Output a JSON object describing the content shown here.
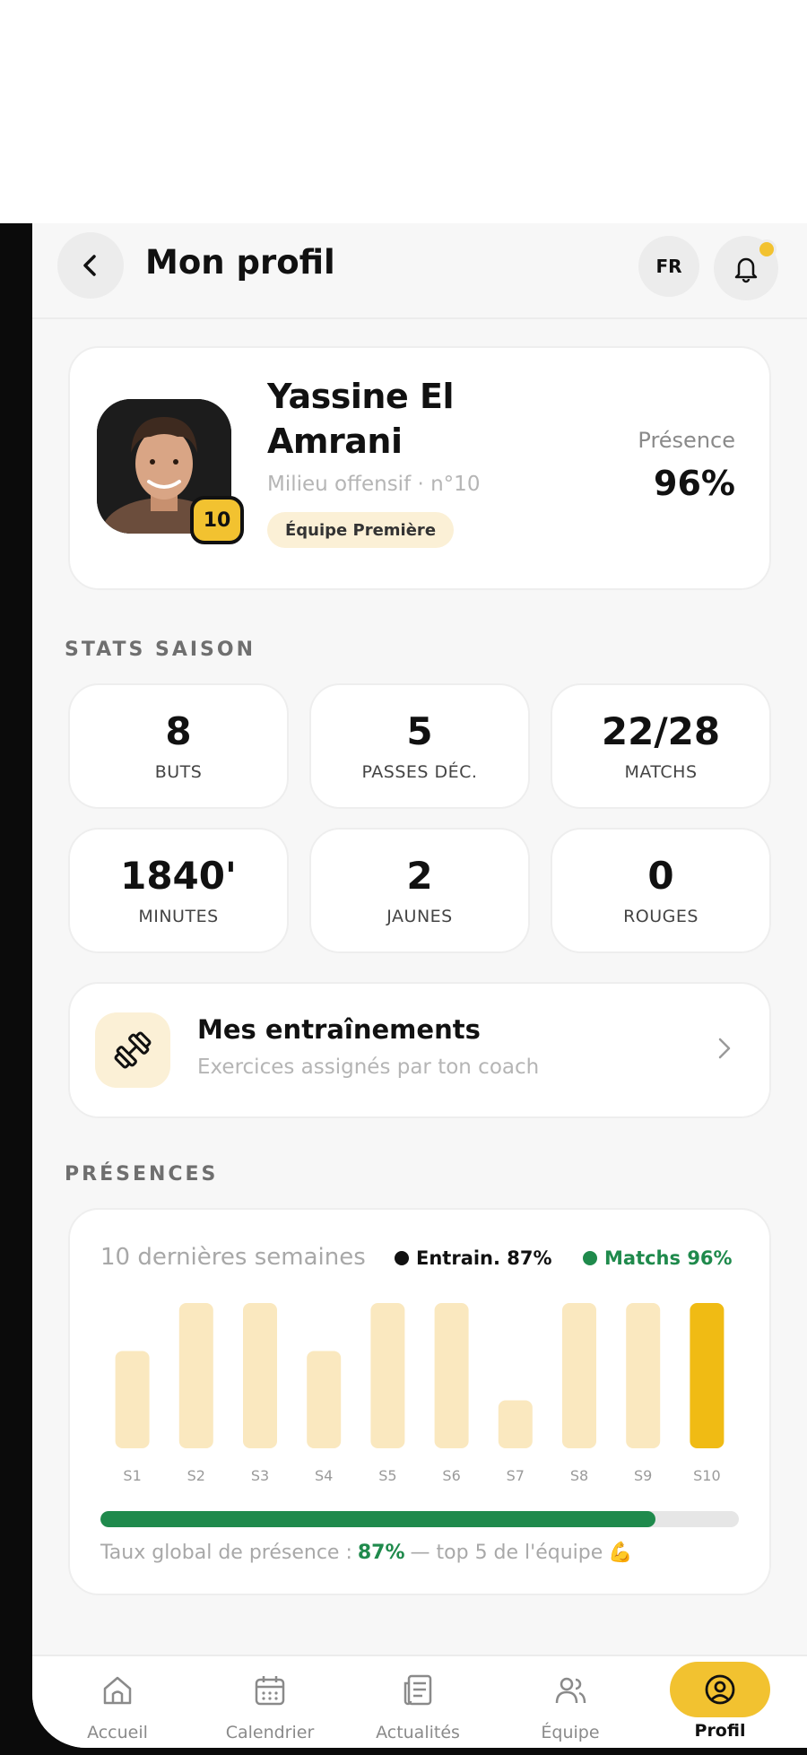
{
  "header": {
    "title": "Mon profil",
    "lang": "FR"
  },
  "profile": {
    "name": "Yassine El Amrani",
    "role": "Milieu offensif · n°10",
    "team": "Équipe Première",
    "number": "10",
    "presence_label": "Présence",
    "presence_value": "96%"
  },
  "stats": {
    "section_title": "STATS SAISON",
    "items": [
      {
        "value": "8",
        "label": "BUTS"
      },
      {
        "value": "5",
        "label": "PASSES DÉC."
      },
      {
        "value": "22/28",
        "label": "MATCHS"
      },
      {
        "value": "1840'",
        "label": "MINUTES"
      },
      {
        "value": "2",
        "label": "JAUNES"
      },
      {
        "value": "0",
        "label": "ROUGES"
      }
    ]
  },
  "training": {
    "title": "Mes entraînements",
    "subtitle": "Exercices assignés par ton coach"
  },
  "presences": {
    "section_title": "PRÉSENCES",
    "subtitle": "10 dernières semaines",
    "legend_training": "Entrain. 87%",
    "legend_matches": "Matchs 96%",
    "progress_prefix": "Taux global de présence :",
    "progress_value": "87%",
    "progress_suffix": "— top 5 de l'équipe",
    "progress_fraction": 0.87,
    "emoji": "💪"
  },
  "chart_data": {
    "type": "bar",
    "categories": [
      "S1",
      "S2",
      "S3",
      "S4",
      "S5",
      "S6",
      "S7",
      "S8",
      "S9",
      "S10"
    ],
    "values": [
      67,
      100,
      100,
      67,
      100,
      100,
      33,
      100,
      100,
      100
    ],
    "highlight_index": 9,
    "ylim": [
      0,
      100
    ],
    "colors": {
      "bar": "#fae8bf",
      "highlight": "#f0bb14"
    }
  },
  "nav": {
    "items": [
      {
        "label": "Accueil",
        "icon": "home-icon"
      },
      {
        "label": "Calendrier",
        "icon": "calendar-icon"
      },
      {
        "label": "Actualités",
        "icon": "news-icon"
      },
      {
        "label": "Équipe",
        "icon": "team-icon"
      },
      {
        "label": "Profil",
        "icon": "profile-icon"
      }
    ],
    "active_index": 4
  },
  "colors": {
    "accent": "#f2c230",
    "green": "#1f8a4c",
    "background": "#f7f7f7"
  }
}
